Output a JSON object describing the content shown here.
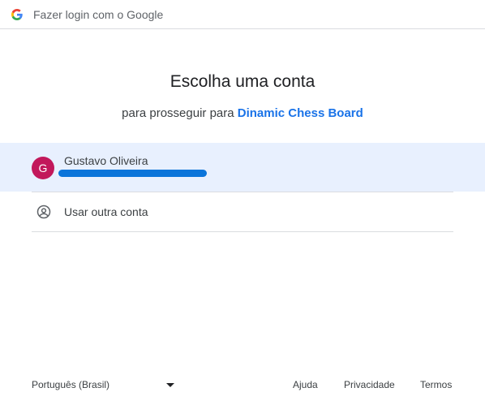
{
  "header": {
    "title": "Fazer login com o Google",
    "logo_icon": "google-g-icon"
  },
  "main": {
    "title": "Escolha uma conta",
    "subtitle_prefix": "para prosseguir para ",
    "app_name": "Dinamic Chess Board"
  },
  "accounts": [
    {
      "avatar_letter": "G",
      "name": "Gustavo Oliveira",
      "avatar_color": "#c2185b"
    }
  ],
  "other_account": {
    "label": "Usar outra conta",
    "icon": "account-circle-icon"
  },
  "footer": {
    "language": "Português (Brasil)",
    "help": "Ajuda",
    "privacy": "Privacidade",
    "terms": "Termos"
  },
  "colors": {
    "accent": "#1a73e8",
    "selected_row": "#e8f0fe",
    "divider": "#dadce0"
  }
}
